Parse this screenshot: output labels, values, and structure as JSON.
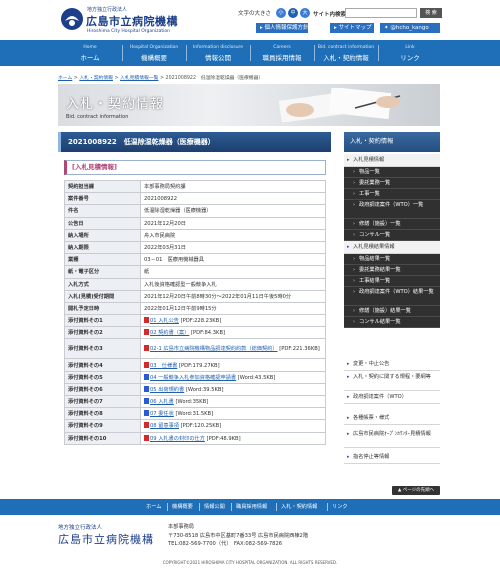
{
  "header": {
    "org_small": "地方独立行政法人",
    "org_name": "広島市立病院機構",
    "org_en": "Hiroshima City Hospital Organization",
    "font_size_label": "文字の大きさ",
    "font_sizes": [
      "小",
      "中",
      "大"
    ],
    "search_label": "サイト内検索",
    "search_button": "検 索",
    "buttons": [
      "個人情報保護方針",
      "サイトマップ",
      "@hcho_kango"
    ],
    "colors": {
      "brand": "#1e6fb8",
      "navy": "#1d3f8a",
      "button": "#2a6fc0"
    }
  },
  "gnav": [
    {
      "en": "Home",
      "jp": "ホーム"
    },
    {
      "en": "Hospital Organization",
      "jp": "機構概要"
    },
    {
      "en": "Information disclosure",
      "jp": "情報公開"
    },
    {
      "en": "Careers",
      "jp": "職員採用情報"
    },
    {
      "en": "Bid. contract information",
      "jp": "入札・契約情報"
    },
    {
      "en": "Link",
      "jp": "リンク"
    }
  ],
  "breadcrumb": {
    "items": [
      "ホーム",
      "入札・契約情報",
      "入札見積情報一覧",
      "2021008922　低温除湿乾燥器（医療機器）"
    ],
    "sep": ">"
  },
  "banner": {
    "title": "入札・契約情報",
    "subtitle": "Bid. contract information"
  },
  "main": {
    "headline": "2021008922　低温除湿乾燥器（医療機器）",
    "subhead": "[入札見積情報]",
    "rows": [
      {
        "label": "契約担当課",
        "value": "本部事務局契約課"
      },
      {
        "label": "案件番号",
        "value": "2021008922"
      },
      {
        "label": "件名",
        "value": "低温除湿乾燥器（医療機器）"
      },
      {
        "label": "公告日",
        "value": "2021年12月20日"
      },
      {
        "label": "納入場所",
        "value": "舟入市民病院"
      },
      {
        "label": "納入期限",
        "value": "2022年03月31日"
      },
      {
        "label": "業種",
        "value": "03－01　医療用機械器具"
      },
      {
        "label": "紙・電子区分",
        "value": "紙"
      },
      {
        "label": "入札方式",
        "value": "入札後資格確認型一般競争入札"
      },
      {
        "label": "入札(見積)受付期間",
        "value": "2021年12月20日午前8時30分～2022年01月11日午後5時0分"
      },
      {
        "label": "開札予定日時",
        "value": "2022年01月12日午前9時15分"
      }
    ],
    "attachments": [
      {
        "label": "添付資料その1",
        "link": "01 入札公告",
        "meta": "[PDF:228.23KB]",
        "type": "pdf"
      },
      {
        "label": "添付資料その2",
        "link": "02 契約書（案）",
        "meta": "[PDF:84.3KB]",
        "type": "pdf"
      },
      {
        "label": "添付資料その3",
        "link": "02-1 広島市立病院機構物品調達契約約款（総価契約）",
        "meta": "[PDF:221.36KB]",
        "type": "pdf"
      },
      {
        "label": "添付資料その4",
        "link": "03　仕様書",
        "meta": "[PDF:179.27KB]",
        "type": "pdf"
      },
      {
        "label": "添付資料その5",
        "link": "04 一般競争入札参加資格確認申請書",
        "meta": "[Word:43.5KB]",
        "type": "word"
      },
      {
        "label": "添付資料その6",
        "link": "05 出荷規約書",
        "meta": "[Word:39.5KB]",
        "type": "word"
      },
      {
        "label": "添付資料その7",
        "link": "06 入札書",
        "meta": "[Word:35KB]",
        "type": "word"
      },
      {
        "label": "添付資料その8",
        "link": "07 委任状",
        "meta": "[Word:31.5KB]",
        "type": "word"
      },
      {
        "label": "添付資料その9",
        "link": "08 留意事項",
        "meta": "[PDF:120.25KB]",
        "type": "pdf"
      },
      {
        "label": "添付資料その10",
        "link": "09 入札書の封印の仕方",
        "meta": "[PDF:48.9KB]",
        "type": "pdf"
      }
    ]
  },
  "side": {
    "title": "入札・契約情報",
    "items": [
      {
        "kind": "top",
        "label": "入札見積情報"
      },
      {
        "kind": "sub",
        "label": "物品一覧"
      },
      {
        "kind": "sub",
        "label": "委託業務一覧"
      },
      {
        "kind": "sub",
        "label": "工事一覧"
      },
      {
        "kind": "sub",
        "label": "政府調達案件（WTO）一覧"
      },
      {
        "kind": "sub",
        "label": "修繕（施設）一覧"
      },
      {
        "kind": "sub",
        "label": "コンサル一覧"
      },
      {
        "kind": "top",
        "label": "入札見積結果情報"
      },
      {
        "kind": "sub",
        "label": "物品結果一覧"
      },
      {
        "kind": "sub",
        "label": "委託業務結果一覧"
      },
      {
        "kind": "sub",
        "label": "工事結果一覧"
      },
      {
        "kind": "sub",
        "label": "政府調達案件（WTO）結果一覧"
      },
      {
        "kind": "sub",
        "label": "修繕（施設）結果一覧"
      },
      {
        "kind": "sub",
        "label": "コンサル結果一覧"
      },
      {
        "kind": "plain",
        "label": "変更・中止公告"
      },
      {
        "kind": "plain",
        "label": "入札・契約に関する規程・要綱等"
      },
      {
        "kind": "plain",
        "label": "政府調達案件（WTO）"
      },
      {
        "kind": "plain",
        "label": "各種帳票・様式"
      },
      {
        "kind": "plain",
        "label": "広島市民病院ｵｰﾌﾟﾝｶｳﾝﾀｰ見積情報"
      },
      {
        "kind": "plain",
        "label": "指名停止等情報"
      }
    ]
  },
  "page_top": "ページの先頭へ",
  "footer_nav": [
    "ホーム",
    "機構概要",
    "情報公開",
    "職員採用情報",
    "入札・契約情報",
    "リンク"
  ],
  "footer": {
    "org_small": "地方独立行政法人",
    "org_name": "広島市立病院機構",
    "office": "本部事務局",
    "address": "〒730-8518 広島市中区基町7番33号 広島市民病院西棟2階",
    "tel_fax": "TEL:082-569-7700（代）　FAX:082-569-7826",
    "copyright": "COPYRIGHT©2021 HIROSHIMA CITY HOSPITAL ORGANIZATION. ALL RIGHTS RESERVED."
  }
}
